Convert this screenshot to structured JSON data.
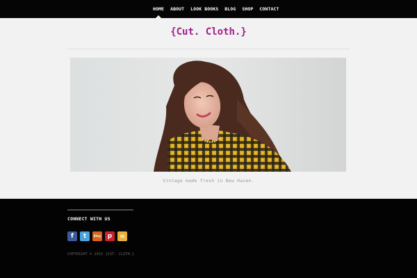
{
  "nav": {
    "items": [
      {
        "label": "HOME",
        "active": true
      },
      {
        "label": "ABOUT"
      },
      {
        "label": "LOOK BOOKS"
      },
      {
        "label": "BLOG"
      },
      {
        "label": "SHOP"
      },
      {
        "label": "CONTACT"
      }
    ]
  },
  "site": {
    "logo": "{Cut. Cloth.}",
    "logo_color": "#a01f8a"
  },
  "hero": {
    "caption": "Vintage made fresh in New Haven."
  },
  "footer": {
    "heading": "CONNECT WITH US",
    "social": [
      {
        "icon": "facebook-icon",
        "color": "#3b5998",
        "glyph": "f"
      },
      {
        "icon": "twitter-icon",
        "color": "#4aa3df",
        "glyph": "t"
      },
      {
        "icon": "etsy-icon",
        "color": "#d5641c",
        "glyph": "Etsy"
      },
      {
        "icon": "pinterest-icon",
        "color": "#c8232c",
        "glyph": "p"
      },
      {
        "icon": "email-icon",
        "color": "#e8b23a",
        "glyph": "✉"
      }
    ],
    "copyright": "COPYRIGHT © 2015 {CUT. CLOTH.}"
  }
}
